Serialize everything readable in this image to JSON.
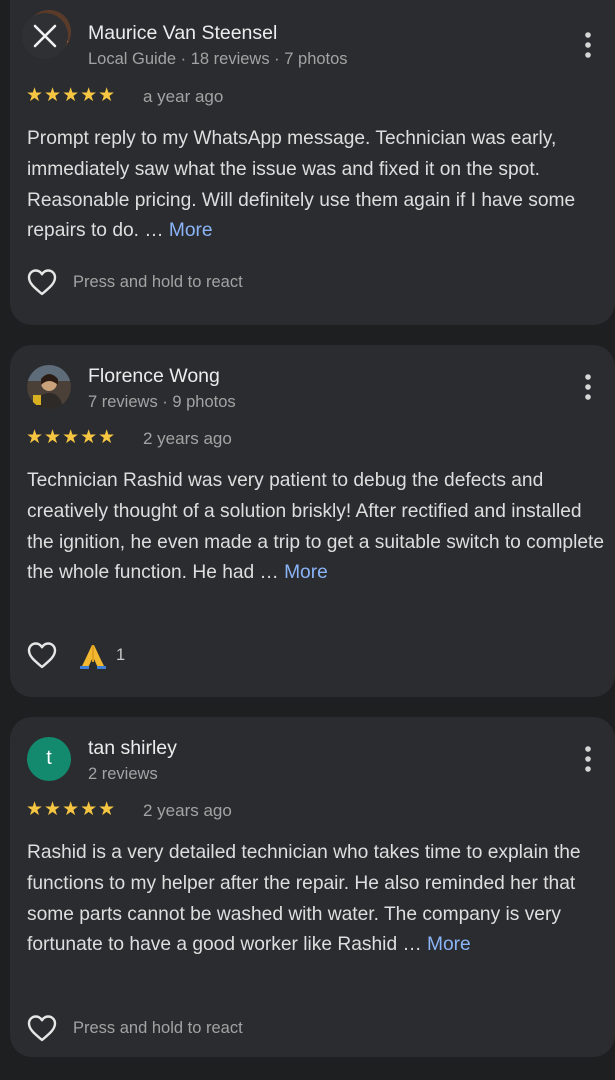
{
  "close_label": "Close",
  "reviews": [
    {
      "name": "Maurice Van Steensel",
      "meta": "Local Guide · 18 reviews · 7 photos",
      "stars": "★★★★★",
      "time": "a year ago",
      "text": "Prompt reply to my WhatsApp message. Technician was early, immediately saw what the issue was and fixed it on the spot. Reasonable pricing. Will definitely use them again if I have some repairs to do. …",
      "more": "More",
      "react": "Press and hold to react"
    },
    {
      "name": "Florence Wong",
      "meta": "7 reviews · 9 photos",
      "stars": "★★★★★",
      "time": "2 years ago",
      "text": "Technician Rashid was very patient to debug the defects and creatively thought of a solution briskly! After rectified and installed the ignition, he even made a trip to get a suitable switch to complete the whole function. He had …",
      "more": "More",
      "reaction_count": "1"
    },
    {
      "name": "tan shirley",
      "meta": "2 reviews",
      "avatar_letter": "t",
      "avatar_color": "#138a6d",
      "stars": "★★★★★",
      "time": "2 years ago",
      "text": "Rashid is a very detailed technician who takes time to explain the functions to my helper after the repair. He also reminded her that some parts cannot be washed with water. The company is very fortunate to have a good worker like Rashid …",
      "more": "More",
      "react": "Press and hold to react"
    }
  ]
}
